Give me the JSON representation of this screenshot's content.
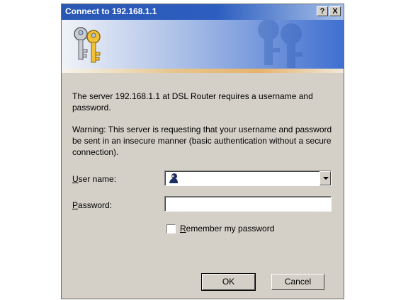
{
  "window": {
    "title": "Connect to 192.168.1.1",
    "help_label": "?",
    "close_label": "X"
  },
  "banner": {
    "icon": "keys-icon"
  },
  "message": {
    "line1": "The server 192.168.1.1 at DSL Router requires a username and password.",
    "warning": "Warning: This server is requesting that your username and password be sent in an insecure manner (basic authentication without a secure connection)."
  },
  "form": {
    "username_label_key": "U",
    "username_label_rest": "ser name:",
    "username_value": "",
    "password_label_key": "P",
    "password_label_rest": "assword:",
    "password_value": "",
    "remember_key": "R",
    "remember_rest": "emember my password",
    "remember_checked": false
  },
  "buttons": {
    "ok": "OK",
    "cancel": "Cancel"
  },
  "colors": {
    "titlebar": "#2a57b4",
    "dialog_bg": "#d4d0c8"
  }
}
